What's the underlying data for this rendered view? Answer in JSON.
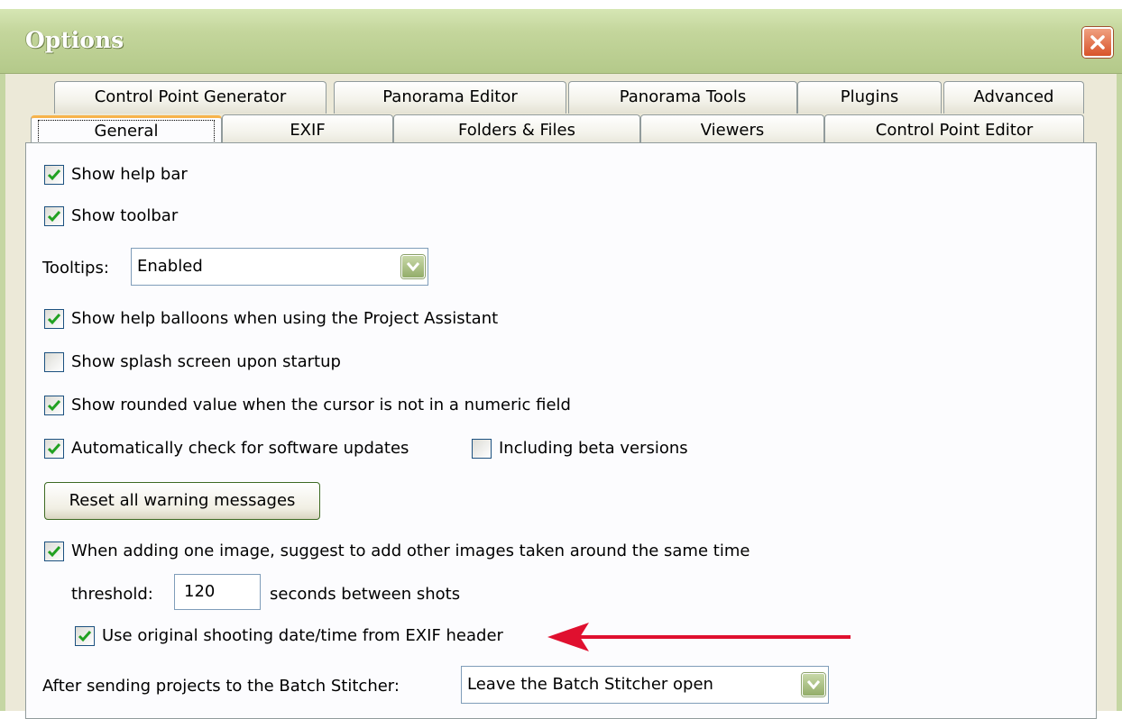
{
  "window": {
    "title": "Options"
  },
  "tabs_row1": [
    "Control Point Generator",
    "Panorama Editor",
    "Panorama Tools",
    "Plugins",
    "Advanced"
  ],
  "tabs_row2": [
    "General",
    "EXIF",
    "Folders & Files",
    "Viewers",
    "Control Point Editor"
  ],
  "general": {
    "show_help_bar": {
      "label": "Show help bar",
      "checked": true
    },
    "show_toolbar": {
      "label": "Show toolbar",
      "checked": true
    },
    "tooltips": {
      "label": "Tooltips:",
      "value": "Enabled"
    },
    "show_help_balloons": {
      "label": "Show help balloons when using the Project Assistant",
      "checked": true
    },
    "show_splash": {
      "label": "Show splash screen upon startup",
      "checked": false
    },
    "show_rounded": {
      "label": "Show rounded value when the cursor is not in a numeric field",
      "checked": true
    },
    "auto_update": {
      "label": "Automatically check for software updates",
      "checked": true
    },
    "beta_versions": {
      "label": "Including beta versions",
      "checked": false
    },
    "reset_warnings": {
      "label": "Reset all warning messages"
    },
    "suggest_images": {
      "label": "When adding one image, suggest to add other images taken around the same time",
      "checked": true
    },
    "threshold": {
      "label": "threshold:",
      "value": "120",
      "suffix": "seconds between shots"
    },
    "use_exif_time": {
      "label": "Use original shooting date/time from EXIF header",
      "checked": true
    },
    "batch_stitcher": {
      "label": "After sending projects to the Batch Stitcher:",
      "value": "Leave the Batch Stitcher open"
    }
  },
  "colors": {
    "annotation_arrow": "#e0102f",
    "tab_highlight": "#f7b34b",
    "checkbox_check": "#21a121"
  }
}
